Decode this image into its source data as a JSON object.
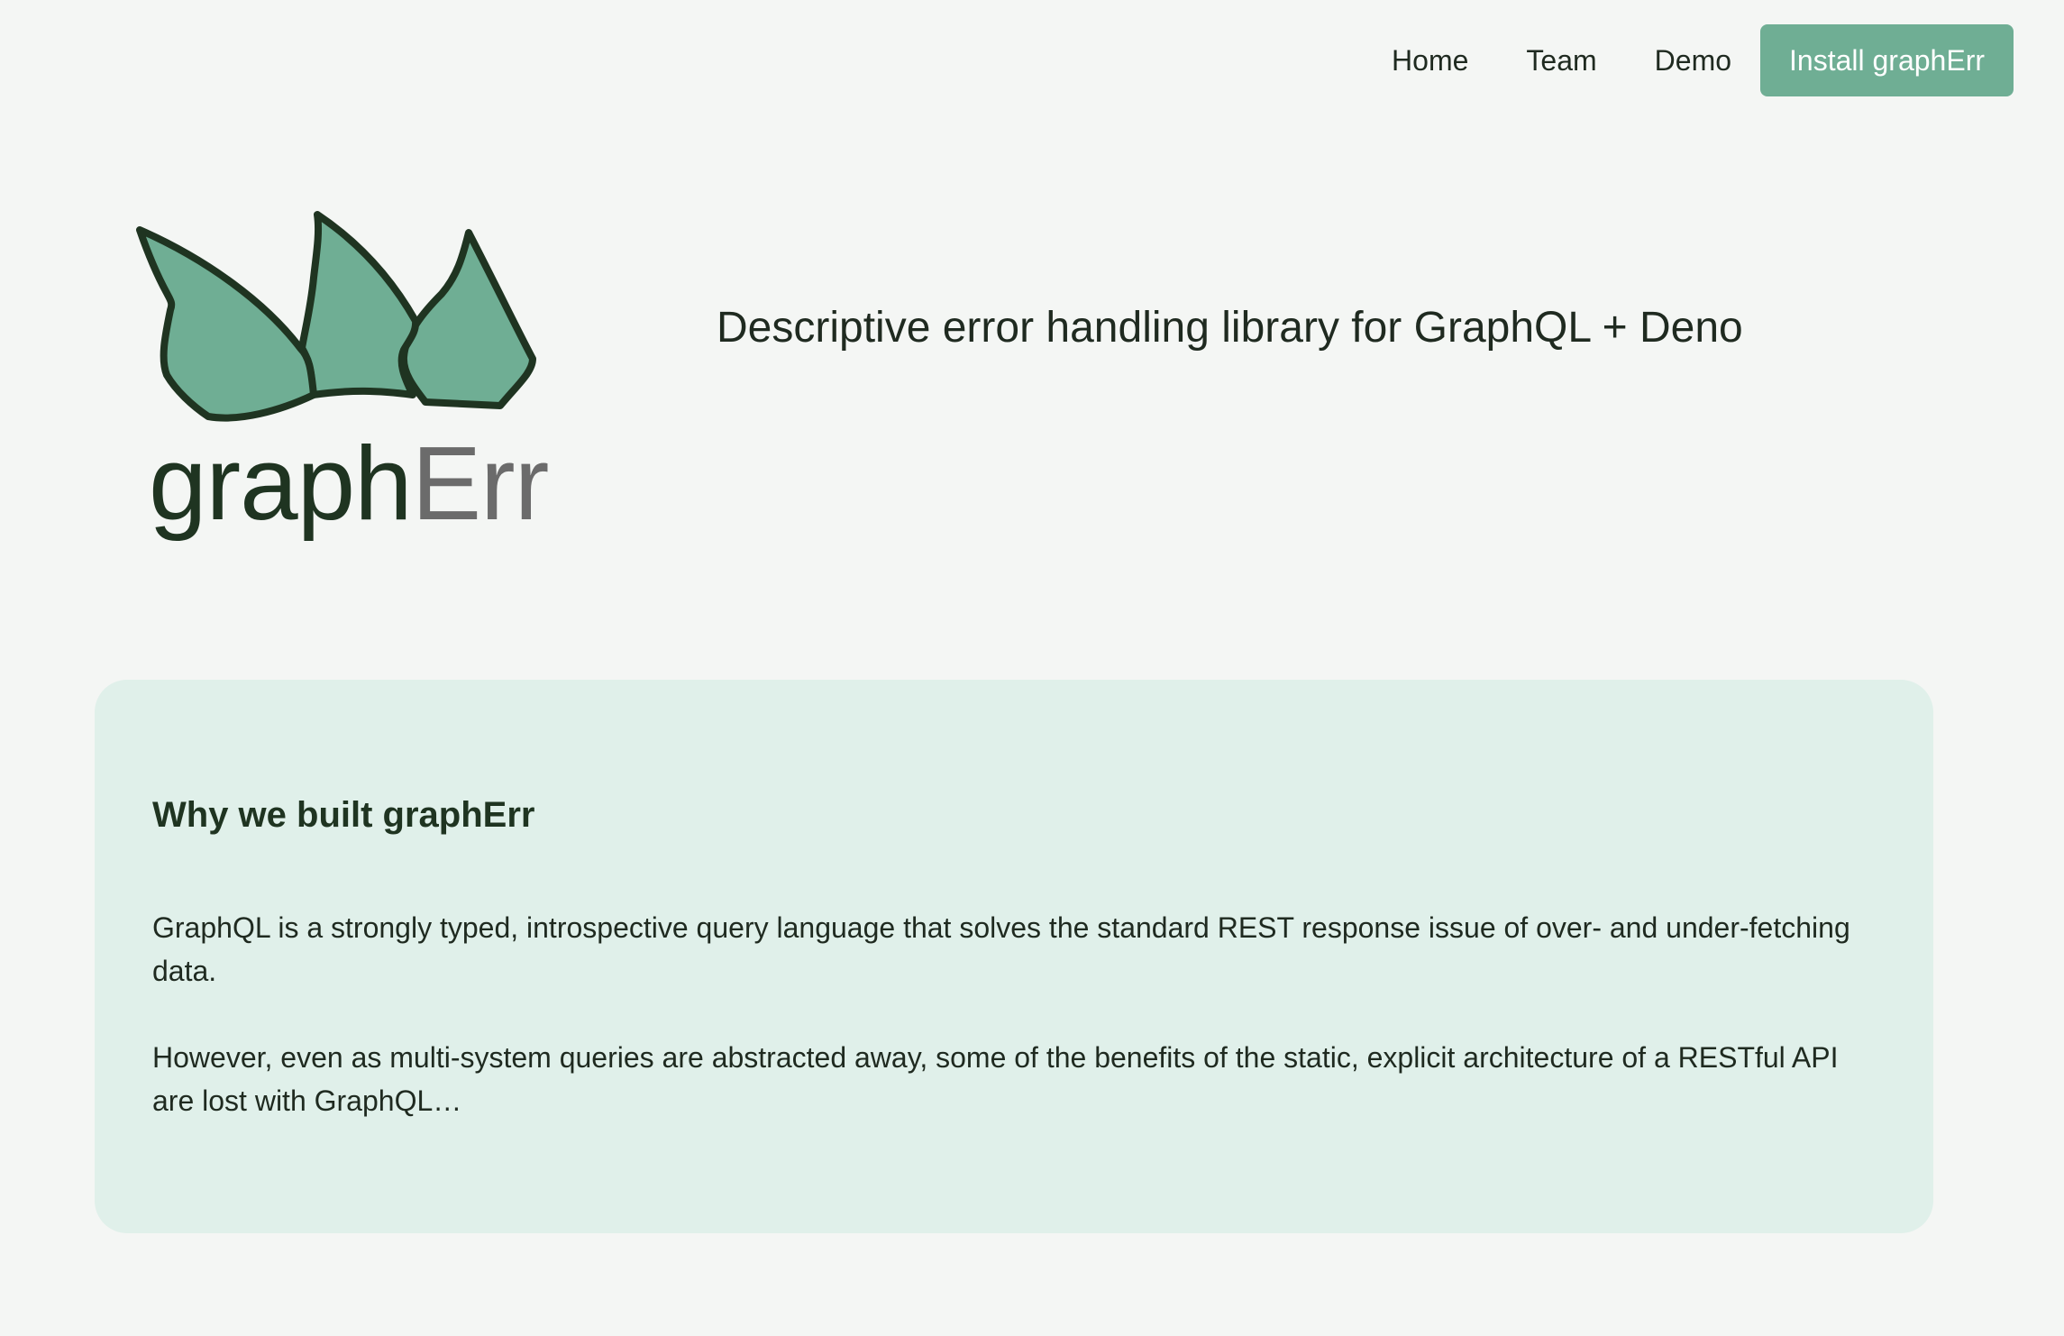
{
  "nav": {
    "links": [
      "Home",
      "Team",
      "Demo"
    ],
    "install_label": "Install graphErr"
  },
  "logo": {
    "word_part1": "graph",
    "word_part2": "Err",
    "icon": "plant-leaves-icon"
  },
  "hero": {
    "tagline": "Descriptive error handling library for GraphQL + Deno"
  },
  "about": {
    "title": "Why we built graphErr",
    "paragraphs": [
      "GraphQL is a strongly typed, introspective query language that solves the standard REST response issue of over- and under-fetching data.",
      "However, even as multi-system queries are abstracted away, some of the benefits of the static, explicit architecture of a RESTful API are lost with GraphQL…"
    ]
  },
  "colors": {
    "accent": "#6fae94",
    "card_bg": "#e0f0ea",
    "page_bg": "#f4f6f4",
    "leaf_fill": "#6fae94",
    "leaf_stroke": "#1f3421",
    "text_dark": "#1f2a20",
    "text_gray": "#6b6b6b"
  }
}
